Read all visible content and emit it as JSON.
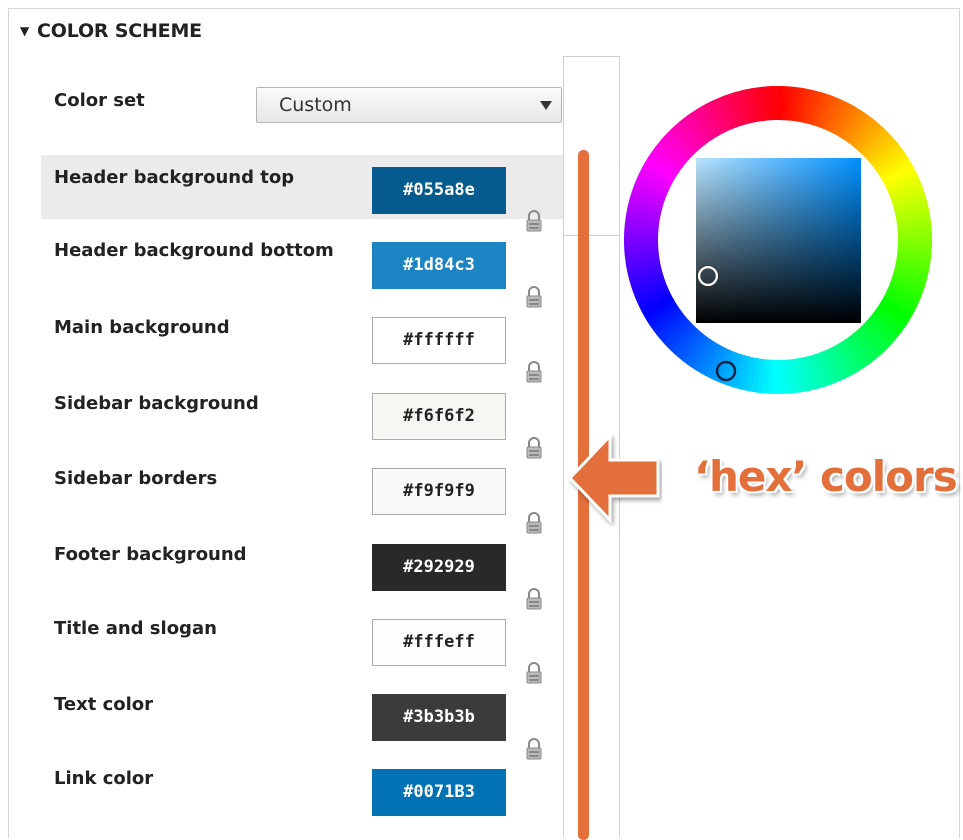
{
  "section": {
    "title": "COLOR SCHEME"
  },
  "color_set": {
    "label": "Color set",
    "selected": "Custom"
  },
  "fields": [
    {
      "label": "Header background top",
      "value": "#055a8e",
      "bg": "#055a8e",
      "fg": "#ffffff",
      "selected": true
    },
    {
      "label": "Header background bottom",
      "value": "#1d84c3",
      "bg": "#1d84c3",
      "fg": "#ffffff"
    },
    {
      "label": "Main background",
      "value": "#ffffff",
      "bg": "#ffffff",
      "fg": "#222222"
    },
    {
      "label": "Sidebar background",
      "value": "#f6f6f2",
      "bg": "#f6f6f2",
      "fg": "#222222"
    },
    {
      "label": "Sidebar borders",
      "value": "#f9f9f9",
      "bg": "#f9f9f9",
      "fg": "#222222"
    },
    {
      "label": "Footer background",
      "value": "#292929",
      "bg": "#292929",
      "fg": "#ffffff"
    },
    {
      "label": "Title and slogan",
      "value": "#fffeff",
      "bg": "#fffeff",
      "fg": "#222222"
    },
    {
      "label": "Text color",
      "value": "#3b3b3b",
      "bg": "#3b3b3b",
      "fg": "#ffffff"
    },
    {
      "label": "Link color",
      "value": "#0071B3",
      "bg": "#0071b3",
      "fg": "#ffffff"
    }
  ],
  "picker": {
    "current_color": "#055a8e"
  },
  "annotation": {
    "text": "‘hex’ colors",
    "color": "#e36f3a"
  },
  "icons": {
    "lock": "lock-icon",
    "collapse": "triangle-down-icon",
    "dropdown": "chevron-down-icon"
  }
}
